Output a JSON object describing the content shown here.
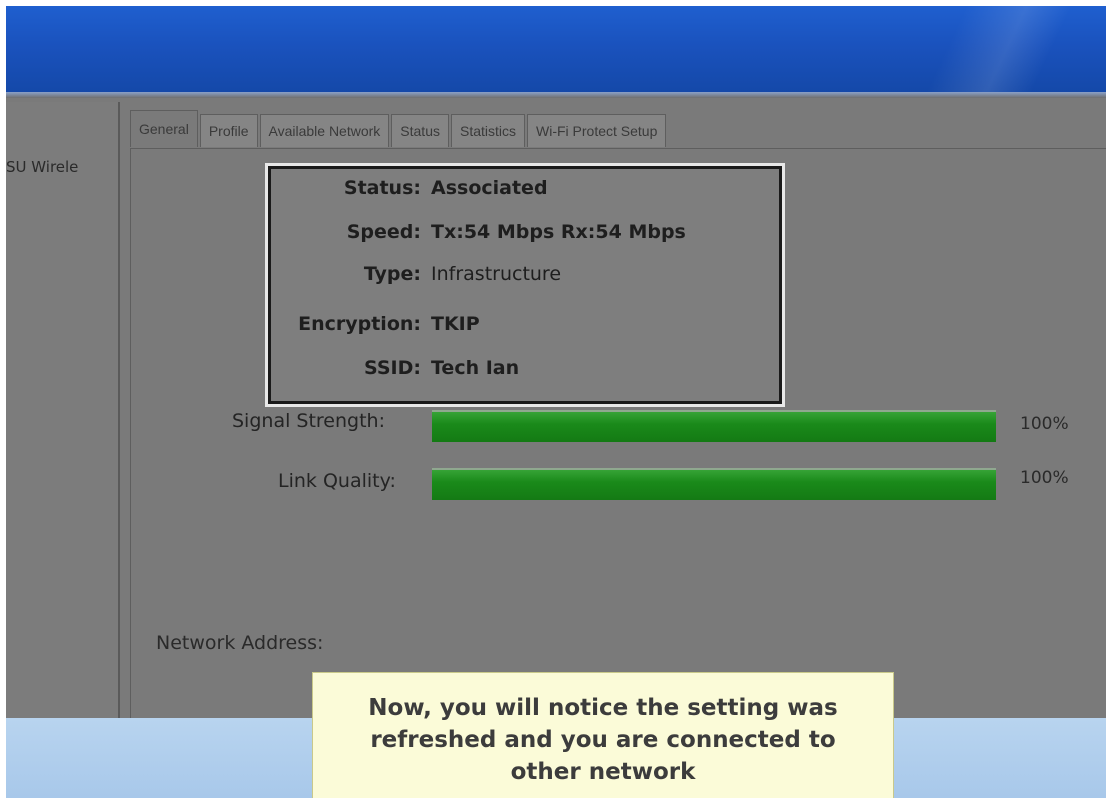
{
  "sidebar": {
    "label": "SU Wirele"
  },
  "tabs": [
    {
      "label": "General",
      "active": true
    },
    {
      "label": "Profile"
    },
    {
      "label": "Available Network"
    },
    {
      "label": "Status"
    },
    {
      "label": "Statistics"
    },
    {
      "label": "Wi-Fi Protect Setup"
    }
  ],
  "info": {
    "status_key": "Status:",
    "status_value": "Associated",
    "speed_key": "Speed:",
    "speed_value": "Tx:54 Mbps Rx:54 Mbps",
    "type_key": "Type:",
    "type_value": "Infrastructure",
    "encryption_key": "Encryption:",
    "encryption_value": "TKIP",
    "ssid_key": "SSID:",
    "ssid_value": "Tech Ian"
  },
  "meters": {
    "signal_label": "Signal Strength:",
    "signal_percent": "100%",
    "signal_level": 1.0,
    "link_label": "Link Quality:",
    "link_percent": "100%",
    "link_level": 1.0
  },
  "network": {
    "label": "Network Address:"
  },
  "caption": {
    "text": "Now, you will notice the setting was refreshed and you are connected to other network"
  },
  "colors": {
    "meter_green": "#1a8a1a",
    "title_blue": "#1a52bd",
    "caption_bg": "#fbfbd8"
  }
}
